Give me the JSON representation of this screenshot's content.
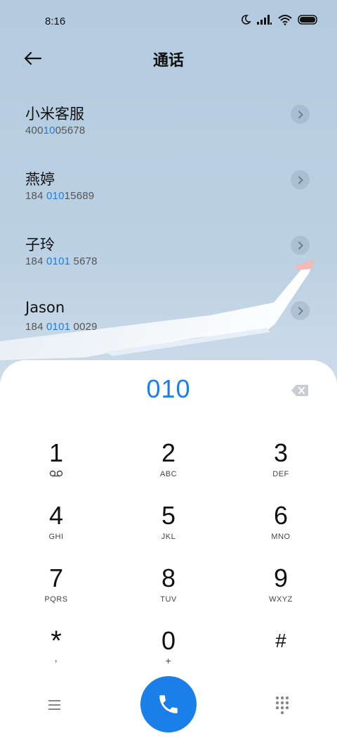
{
  "status_bar": {
    "time": "8:16",
    "icons": [
      "moon-icon",
      "signal-icon",
      "wifi-icon",
      "battery-icon"
    ]
  },
  "header": {
    "title": "通话",
    "back_icon": "arrow-left-icon"
  },
  "contacts": [
    {
      "name": "小米客服",
      "number_pre": "400",
      "number_match": "10",
      "number_post": "05678"
    },
    {
      "name": "燕婷",
      "number_pre": "184 ",
      "number_match": "010",
      "number_post": "15689"
    },
    {
      "name": "子玲",
      "number_pre": "184 ",
      "number_match": "0101",
      "number_post": " 5678"
    },
    {
      "name": "Jason",
      "number_pre": "184 ",
      "number_match": "0101",
      "number_post": " 0029"
    }
  ],
  "dialer": {
    "input": "010",
    "keys": [
      {
        "digit": "1",
        "sub": ""
      },
      {
        "digit": "2",
        "sub": "ABC"
      },
      {
        "digit": "3",
        "sub": "DEF"
      },
      {
        "digit": "4",
        "sub": "GHI"
      },
      {
        "digit": "5",
        "sub": "JKL"
      },
      {
        "digit": "6",
        "sub": "MNO"
      },
      {
        "digit": "7",
        "sub": "PQRS"
      },
      {
        "digit": "8",
        "sub": "TUV"
      },
      {
        "digit": "9",
        "sub": "WXYZ"
      },
      {
        "digit": "*",
        "sub": ","
      },
      {
        "digit": "0",
        "sub": "+"
      },
      {
        "digit": "#",
        "sub": ""
      }
    ]
  },
  "colors": {
    "accent": "#1a7fe8",
    "panel": "#ffffff",
    "background_top": "#b3cadf"
  }
}
